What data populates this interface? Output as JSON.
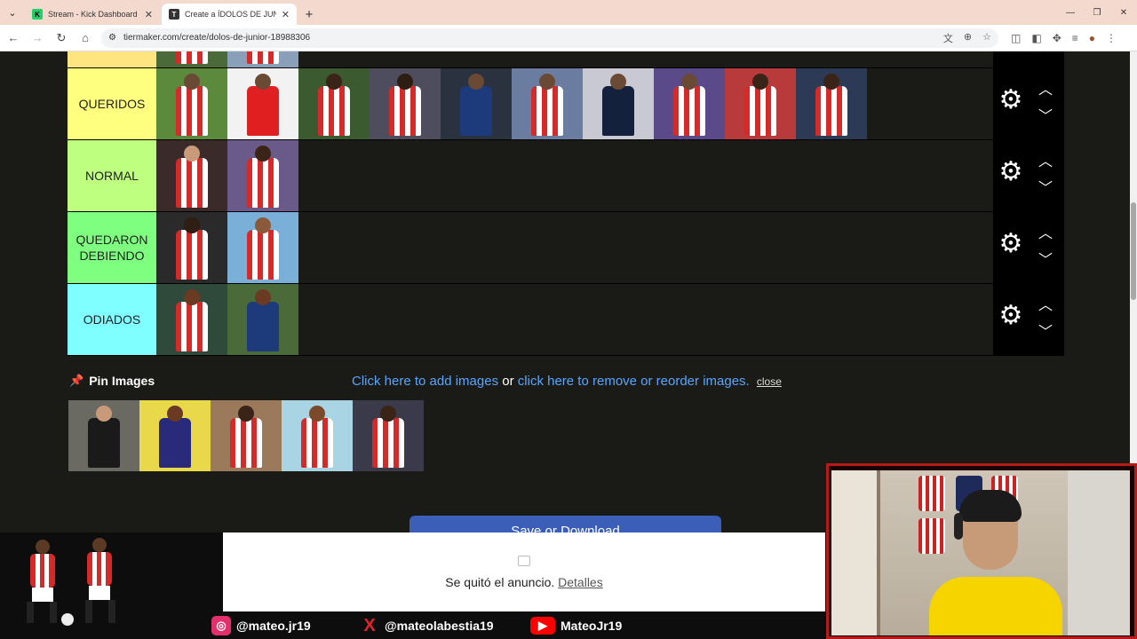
{
  "browser": {
    "tabs": [
      {
        "title": "Stream - Kick Dashboard",
        "favicon": "K",
        "color": "#1fd16a",
        "active": false
      },
      {
        "title": "Create a ÍDOLOS DE JUNIOR Ti...",
        "favicon": "T",
        "color": "#333333",
        "active": true
      }
    ],
    "url": "tiermaker.com/create/dolos-de-junior-18988306"
  },
  "tiers": [
    {
      "label": "",
      "color": "#ffe57f"
    },
    {
      "label": "QUERIDOS",
      "color": "#ffff7f",
      "count": 10
    },
    {
      "label": "NORMAL",
      "color": "#bfff7f",
      "count": 2
    },
    {
      "label": "QUEDARON DEBIENDO",
      "color": "#7fff7f",
      "count": 2
    },
    {
      "label": "ODIADOS",
      "color": "#7fffff",
      "count": 2
    }
  ],
  "pin": {
    "label": "Pin Images",
    "links": {
      "add": "Click here to add images",
      "or": "or",
      "remove": "click here to remove or reorder images.",
      "close": "close"
    },
    "count": 5
  },
  "save_button": "Save or Download",
  "ad": {
    "message": "Se quitó el anuncio.",
    "details": "Detalles"
  },
  "socials": [
    {
      "handle": "@mateo.jr19",
      "icon": "instagram-icon",
      "color": "#e1306c"
    },
    {
      "handle": "@mateolabestia19",
      "icon": "x-icon",
      "color": "#e0232c"
    },
    {
      "handle": "MateoJr19",
      "icon": "youtube-icon",
      "color": "#ff0000"
    }
  ]
}
